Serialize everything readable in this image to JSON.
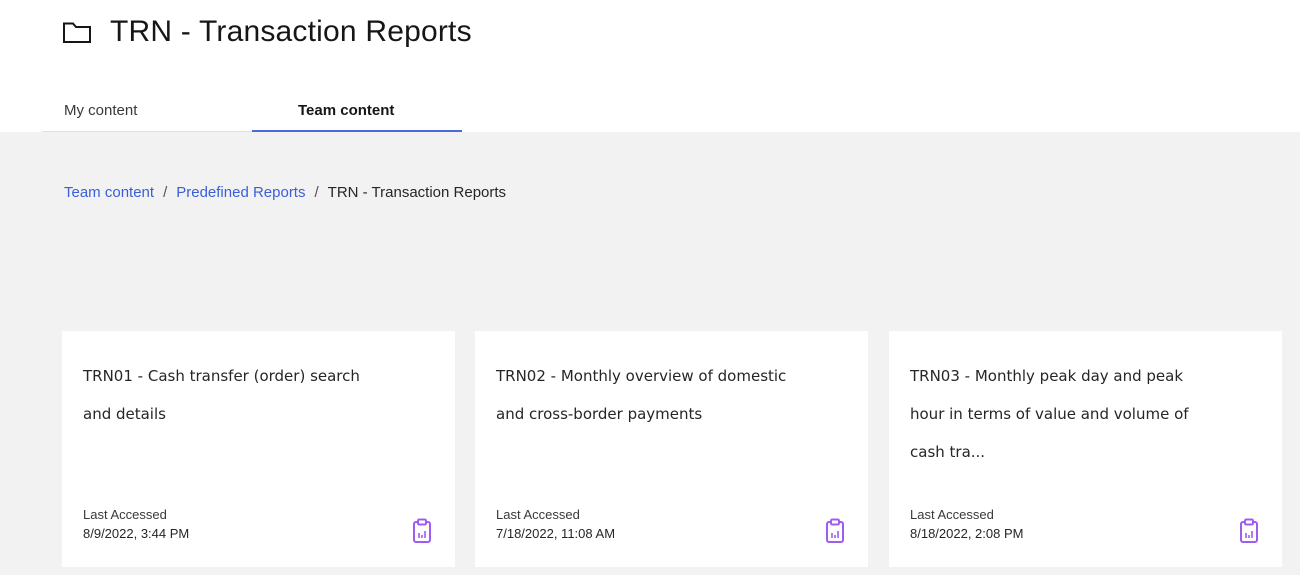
{
  "header": {
    "title": "TRN - Transaction Reports",
    "icon": "folder-icon"
  },
  "tabs": [
    {
      "label": "My content",
      "active": false
    },
    {
      "label": "Team content",
      "active": true
    }
  ],
  "breadcrumb": {
    "items": [
      {
        "label": "Team content",
        "link": true
      },
      {
        "label": "Predefined Reports",
        "link": true
      },
      {
        "label": "TRN - Transaction Reports",
        "link": false
      }
    ],
    "separator": "/"
  },
  "cards": [
    {
      "title": "TRN01 - Cash transfer (order) search and details",
      "accessed_label": "Last Accessed",
      "accessed_date": "8/9/2022, 3:44 PM",
      "icon": "report-icon"
    },
    {
      "title": "TRN02 - Monthly overview of domestic and cross-border payments",
      "accessed_label": "Last Accessed",
      "accessed_date": "7/18/2022, 11:08 AM",
      "icon": "report-icon"
    },
    {
      "title": "TRN03 - Monthly peak day and peak hour in terms of value and volume of cash tra...",
      "accessed_label": "Last Accessed",
      "accessed_date": "8/18/2022, 2:08 PM",
      "icon": "report-icon"
    }
  ],
  "colors": {
    "link": "#3a5fd9",
    "tab_underline": "#4a6bd8",
    "icon_purple": "#a05cf0",
    "content_bg": "#f2f2f2"
  }
}
